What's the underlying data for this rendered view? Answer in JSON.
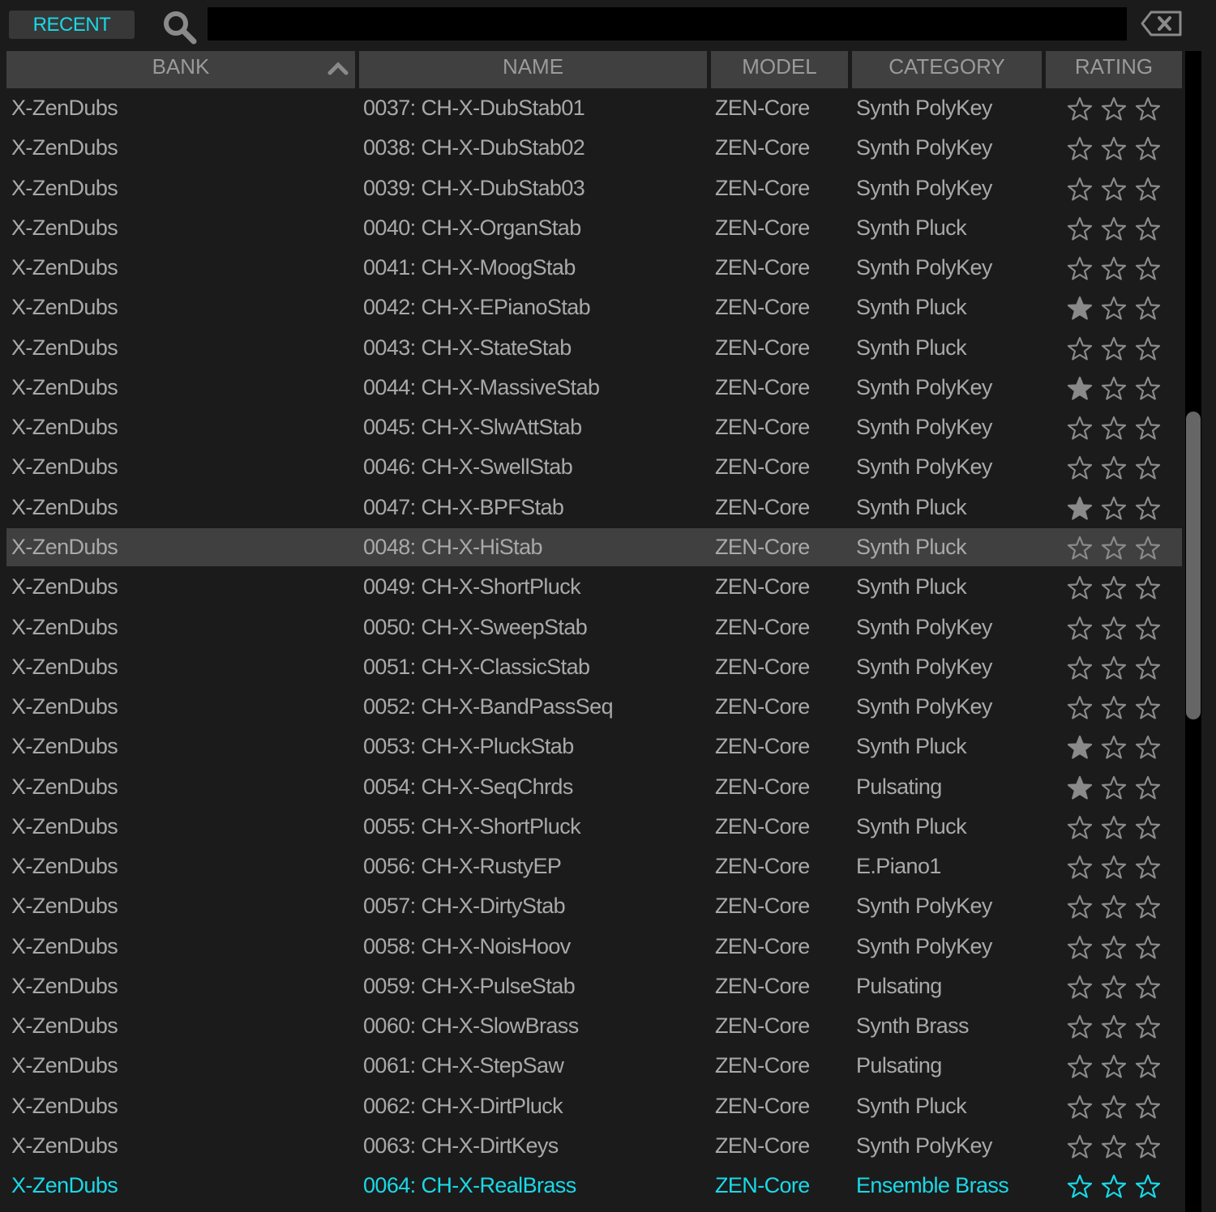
{
  "toolbar": {
    "recent_label": "RECENT",
    "search_value": "",
    "search_icon": "search-icon",
    "clear_icon": "backspace-clear-icon"
  },
  "columns": [
    {
      "key": "bank",
      "label": "BANK",
      "sorted": "ascending"
    },
    {
      "key": "name",
      "label": "NAME"
    },
    {
      "key": "model",
      "label": "MODEL"
    },
    {
      "key": "category",
      "label": "CATEGORY"
    },
    {
      "key": "rating",
      "label": "RATING"
    }
  ],
  "colors": {
    "accent": "#19d9e8",
    "text": "#a9a9a9",
    "header_bg": "#404040",
    "selected_bg": "#404040",
    "bg": "#1b1b1b"
  },
  "rows": [
    {
      "bank": "X-ZenDubs",
      "name": "0037: CH-X-DubStab01",
      "model": "ZEN-Core",
      "category": "Synth PolyKey",
      "rating": 0
    },
    {
      "bank": "X-ZenDubs",
      "name": "0038: CH-X-DubStab02",
      "model": "ZEN-Core",
      "category": "Synth PolyKey",
      "rating": 0
    },
    {
      "bank": "X-ZenDubs",
      "name": "0039: CH-X-DubStab03",
      "model": "ZEN-Core",
      "category": "Synth PolyKey",
      "rating": 0
    },
    {
      "bank": "X-ZenDubs",
      "name": "0040: CH-X-OrganStab",
      "model": "ZEN-Core",
      "category": "Synth Pluck",
      "rating": 0
    },
    {
      "bank": "X-ZenDubs",
      "name": "0041: CH-X-MoogStab",
      "model": "ZEN-Core",
      "category": "Synth PolyKey",
      "rating": 0
    },
    {
      "bank": "X-ZenDubs",
      "name": "0042: CH-X-EPianoStab",
      "model": "ZEN-Core",
      "category": "Synth Pluck",
      "rating": 1
    },
    {
      "bank": "X-ZenDubs",
      "name": "0043: CH-X-StateStab",
      "model": "ZEN-Core",
      "category": "Synth Pluck",
      "rating": 0
    },
    {
      "bank": "X-ZenDubs",
      "name": "0044: CH-X-MassiveStab",
      "model": "ZEN-Core",
      "category": "Synth PolyKey",
      "rating": 1
    },
    {
      "bank": "X-ZenDubs",
      "name": "0045: CH-X-SlwAttStab",
      "model": "ZEN-Core",
      "category": "Synth PolyKey",
      "rating": 0
    },
    {
      "bank": "X-ZenDubs",
      "name": "0046: CH-X-SwellStab",
      "model": "ZEN-Core",
      "category": "Synth PolyKey",
      "rating": 0
    },
    {
      "bank": "X-ZenDubs",
      "name": "0047: CH-X-BPFStab",
      "model": "ZEN-Core",
      "category": "Synth Pluck",
      "rating": 1
    },
    {
      "bank": "X-ZenDubs",
      "name": "0048: CH-X-HiStab",
      "model": "ZEN-Core",
      "category": "Synth Pluck",
      "rating": 0,
      "selected": true
    },
    {
      "bank": "X-ZenDubs",
      "name": "0049: CH-X-ShortPluck",
      "model": "ZEN-Core",
      "category": "Synth Pluck",
      "rating": 0
    },
    {
      "bank": "X-ZenDubs",
      "name": "0050: CH-X-SweepStab",
      "model": "ZEN-Core",
      "category": "Synth PolyKey",
      "rating": 0
    },
    {
      "bank": "X-ZenDubs",
      "name": "0051: CH-X-ClassicStab",
      "model": "ZEN-Core",
      "category": "Synth PolyKey",
      "rating": 0
    },
    {
      "bank": "X-ZenDubs",
      "name": "0052: CH-X-BandPassSeq",
      "model": "ZEN-Core",
      "category": "Synth PolyKey",
      "rating": 0
    },
    {
      "bank": "X-ZenDubs",
      "name": "0053: CH-X-PluckStab",
      "model": "ZEN-Core",
      "category": "Synth Pluck",
      "rating": 1
    },
    {
      "bank": "X-ZenDubs",
      "name": "0054: CH-X-SeqChrds",
      "model": "ZEN-Core",
      "category": "Pulsating",
      "rating": 1
    },
    {
      "bank": "X-ZenDubs",
      "name": "0055: CH-X-ShortPluck",
      "model": "ZEN-Core",
      "category": "Synth Pluck",
      "rating": 0
    },
    {
      "bank": "X-ZenDubs",
      "name": "0056: CH-X-RustyEP",
      "model": "ZEN-Core",
      "category": "E.Piano1",
      "rating": 0
    },
    {
      "bank": "X-ZenDubs",
      "name": "0057: CH-X-DirtyStab",
      "model": "ZEN-Core",
      "category": "Synth PolyKey",
      "rating": 0
    },
    {
      "bank": "X-ZenDubs",
      "name": "0058: CH-X-NoisHoov",
      "model": "ZEN-Core",
      "category": "Synth PolyKey",
      "rating": 0
    },
    {
      "bank": "X-ZenDubs",
      "name": "0059: CH-X-PulseStab",
      "model": "ZEN-Core",
      "category": "Pulsating",
      "rating": 0
    },
    {
      "bank": "X-ZenDubs",
      "name": "0060: CH-X-SlowBrass",
      "model": "ZEN-Core",
      "category": "Synth Brass",
      "rating": 0
    },
    {
      "bank": "X-ZenDubs",
      "name": "0061: CH-X-StepSaw",
      "model": "ZEN-Core",
      "category": "Pulsating",
      "rating": 0
    },
    {
      "bank": "X-ZenDubs",
      "name": "0062: CH-X-DirtPluck",
      "model": "ZEN-Core",
      "category": "Synth Pluck",
      "rating": 0
    },
    {
      "bank": "X-ZenDubs",
      "name": "0063: CH-X-DirtKeys",
      "model": "ZEN-Core",
      "category": "Synth PolyKey",
      "rating": 0
    },
    {
      "bank": "X-ZenDubs",
      "name": "0064: CH-X-RealBrass",
      "model": "ZEN-Core",
      "category": "Ensemble Brass",
      "rating": 0,
      "current": true
    }
  ],
  "scroll": {
    "position_fraction": 0.35,
    "visible_fraction": 0.27
  }
}
